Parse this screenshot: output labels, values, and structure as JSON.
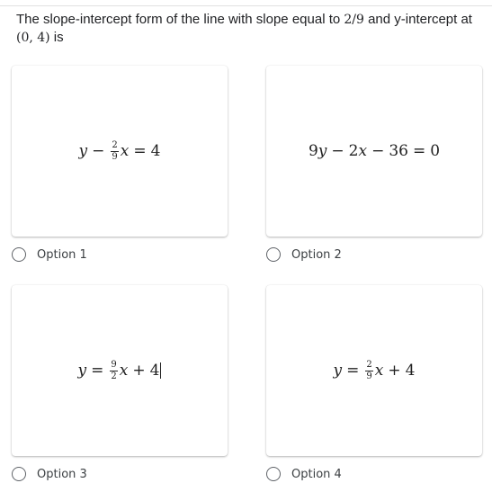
{
  "question": {
    "text_before": "The slope-intercept form of the line with slope equal to ",
    "slope": "2/9",
    "text_middle": " and y-intercept at ",
    "point": "(0, 4)",
    "text_after": " is"
  },
  "options": [
    {
      "label": "Option 1",
      "equation": {
        "lhs_var": "y",
        "op1": "−",
        "frac_num": "2",
        "frac_den": "9",
        "x": "x",
        "eq": "=",
        "rhs": "4"
      }
    },
    {
      "label": "Option 2",
      "equation": {
        "text_a": "9",
        "var_y": "y",
        "op1": "−",
        "text_b": "2",
        "var_x": "x",
        "op2": "−",
        "text_c": "36",
        "eq": "=",
        "rhs": "0"
      }
    },
    {
      "label": "Option 3",
      "equation": {
        "lhs_var": "y",
        "eq": "=",
        "frac_num": "9",
        "frac_den": "2",
        "x": "x",
        "op": "+",
        "rhs": "4"
      }
    },
    {
      "label": "Option 4",
      "equation": {
        "lhs_var": "y",
        "eq": "=",
        "frac_num": "2",
        "frac_den": "9",
        "x": "x",
        "op": "+",
        "rhs": "4"
      }
    }
  ]
}
